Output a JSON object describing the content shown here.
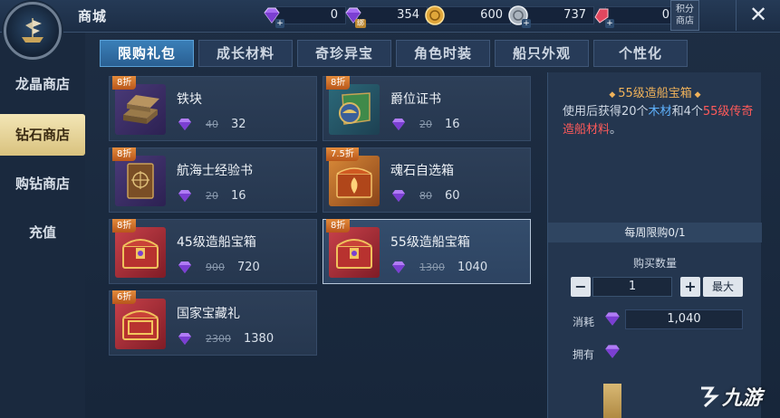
{
  "header": {
    "title": "商城",
    "currencies": [
      {
        "icon": "purple-gem-icon",
        "value": "0"
      },
      {
        "icon": "bound-purple-gem-icon",
        "value": "354"
      },
      {
        "icon": "gold-coin-icon",
        "value": "600"
      },
      {
        "icon": "silver-coin-icon",
        "value": "737"
      },
      {
        "icon": "red-gem-icon",
        "value": "0"
      }
    ],
    "bound_tag": "绑",
    "points_shop_label_1": "积分",
    "points_shop_label_2": "商店",
    "close_label": "✕"
  },
  "sidebar": {
    "items": [
      {
        "label": "龙晶商店",
        "active": false
      },
      {
        "label": "钻石商店",
        "active": true
      },
      {
        "label": "购钻商店",
        "active": false
      },
      {
        "label": "充值",
        "active": false
      }
    ]
  },
  "tabs": [
    {
      "label": "限购礼包",
      "active": true
    },
    {
      "label": "成长材料",
      "active": false
    },
    {
      "label": "奇珍异宝",
      "active": false
    },
    {
      "label": "角色时装",
      "active": false
    },
    {
      "label": "船只外观",
      "active": false
    },
    {
      "label": "个性化",
      "active": false
    }
  ],
  "products": [
    {
      "name": "铁块",
      "discount": "8折",
      "old_price": "40",
      "price": "32",
      "icon": "iron-ingot-icon"
    },
    {
      "name": "爵位证书",
      "discount": "8折",
      "old_price": "20",
      "price": "16",
      "icon": "certificate-icon"
    },
    {
      "name": "航海士经验书",
      "discount": "8折",
      "old_price": "20",
      "price": "16",
      "icon": "book-icon"
    },
    {
      "name": "魂石自选箱",
      "discount": "7.5折",
      "old_price": "80",
      "price": "60",
      "icon": "soulstone-chest-icon"
    },
    {
      "name": "45级造船宝箱",
      "discount": "8折",
      "old_price": "900",
      "price": "720",
      "icon": "treasure-chest-icon"
    },
    {
      "name": "55级造船宝箱",
      "discount": "8折",
      "old_price": "1300",
      "price": "1040",
      "icon": "treasure-chest-icon",
      "selected": true
    },
    {
      "name": "国家宝藏礼",
      "discount": "6折",
      "old_price": "2300",
      "price": "1380",
      "icon": "treasure-chest-icon"
    }
  ],
  "detail": {
    "title": "55级造船宝箱",
    "desc_1": "使用后获得20个",
    "desc_wood": "木材",
    "desc_2": "和4个",
    "desc_red": "55级传奇造船材料",
    "desc_end": "。",
    "weekly_limit": "每周限购0/1",
    "qty_label": "购买数量",
    "qty_value": "1",
    "minus": "−",
    "plus": "+",
    "max_label": "最大",
    "cost_label": "消耗",
    "cost_value": "1,040",
    "own_label": "拥有"
  },
  "watermark": {
    "text": "九游"
  },
  "colors": {
    "accent_gold": "#d9c27e",
    "tab_active": "#2a5f92",
    "title_orange": "#f0b25a",
    "wood_blue": "#5fb3ff",
    "legend_red": "#ff5a5a"
  }
}
